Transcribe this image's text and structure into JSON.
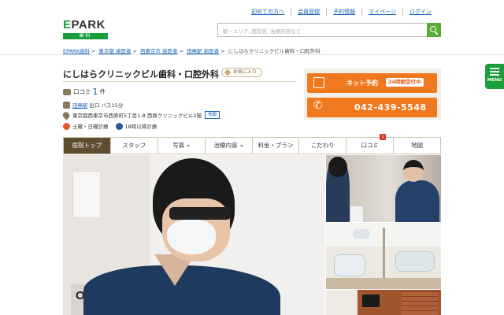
{
  "header": {
    "logo_text": "EPARK",
    "logo_sub": "歯科",
    "links": [
      "初めての方へ",
      "会員登録",
      "予約情報",
      "マイページ",
      "ログイン"
    ],
    "search_placeholder": "駅・エリア, 医院名, 治療内容など"
  },
  "breadcrumb": {
    "items": [
      "EPARK歯科",
      "東京都 歯医者",
      "西東京市 歯医者",
      "田無駅 歯医者"
    ],
    "current": "にしはらクリニックビル歯科・口腔外科",
    "separator": ">"
  },
  "clinic": {
    "name": "にしはらクリニックビル歯科・口腔外科",
    "favorite_label": "お気に入り",
    "review_label": "口コミ",
    "review_count": "1",
    "review_unit": "件",
    "station_link": "田無駅",
    "access_text": "出口 バス15分",
    "address": "東京都西東京市西原町5丁目1-8 西原クリニックビル2階",
    "map_label": "地図",
    "weekend_label": "土曜・日曜診療",
    "late_label": "18時以降診療"
  },
  "reservation": {
    "net_label": "ネット予約",
    "net_badge": "24時間受付中",
    "tel": "042-439-5548"
  },
  "menu_tab": {
    "label": "MENU"
  },
  "tabs": [
    {
      "label": "医院トップ",
      "dropdown": false
    },
    {
      "label": "スタッフ",
      "dropdown": false
    },
    {
      "label": "写真",
      "dropdown": true
    },
    {
      "label": "治療内容",
      "dropdown": true
    },
    {
      "label": "料金・プラン",
      "dropdown": false
    },
    {
      "label": "こだわり",
      "dropdown": false
    },
    {
      "label": "口コミ",
      "dropdown": false,
      "badge": "1"
    },
    {
      "label": "地図",
      "dropdown": false
    }
  ],
  "photos": {
    "sign_text": "OPARK"
  },
  "colors": {
    "brand_green": "#1a9f3c",
    "accent_orange": "#f0781e",
    "link_blue": "#1a66b8",
    "tab_active": "#5d4e30"
  }
}
